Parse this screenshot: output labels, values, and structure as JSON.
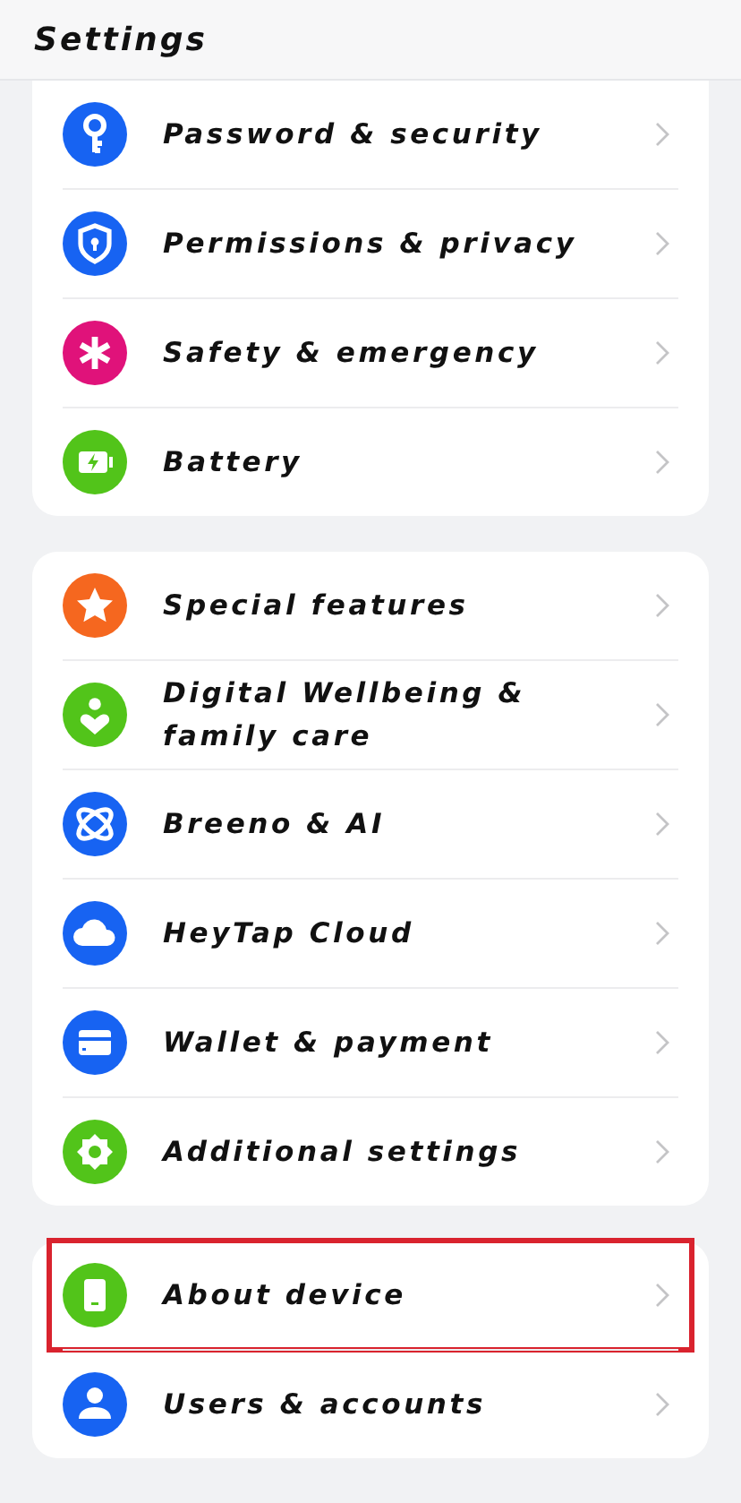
{
  "header": {
    "title": "Settings"
  },
  "groups": [
    {
      "items": [
        {
          "label": "Password & security",
          "kind": "key",
          "color": "#1763f2",
          "highlighted": false
        },
        {
          "label": "Permissions & privacy",
          "kind": "shield",
          "color": "#1763f2",
          "highlighted": false
        },
        {
          "label": "Safety & emergency",
          "kind": "asterisk",
          "color": "#e0127a",
          "highlighted": false
        },
        {
          "label": "Battery",
          "kind": "battery",
          "color": "#52c41a",
          "highlighted": false
        }
      ]
    },
    {
      "items": [
        {
          "label": "Special features",
          "kind": "star",
          "color": "#f5671f",
          "highlighted": false
        },
        {
          "label": "Digital Wellbeing &\nfamily care",
          "kind": "wellbeing",
          "color": "#52c41a",
          "highlighted": false
        },
        {
          "label": "Breeno & AI",
          "kind": "orbit",
          "color": "#1763f2",
          "highlighted": false
        },
        {
          "label": "HeyTap Cloud",
          "kind": "cloud",
          "color": "#1763f2",
          "highlighted": false
        },
        {
          "label": "Wallet & payment",
          "kind": "card",
          "color": "#1763f2",
          "highlighted": false
        },
        {
          "label": "Additional settings",
          "kind": "gear",
          "color": "#52c41a",
          "highlighted": false
        }
      ]
    },
    {
      "items": [
        {
          "label": "About device",
          "kind": "phone",
          "color": "#52c41a",
          "highlighted": true
        },
        {
          "label": "Users & accounts",
          "kind": "person",
          "color": "#1763f2",
          "highlighted": false
        }
      ]
    }
  ]
}
